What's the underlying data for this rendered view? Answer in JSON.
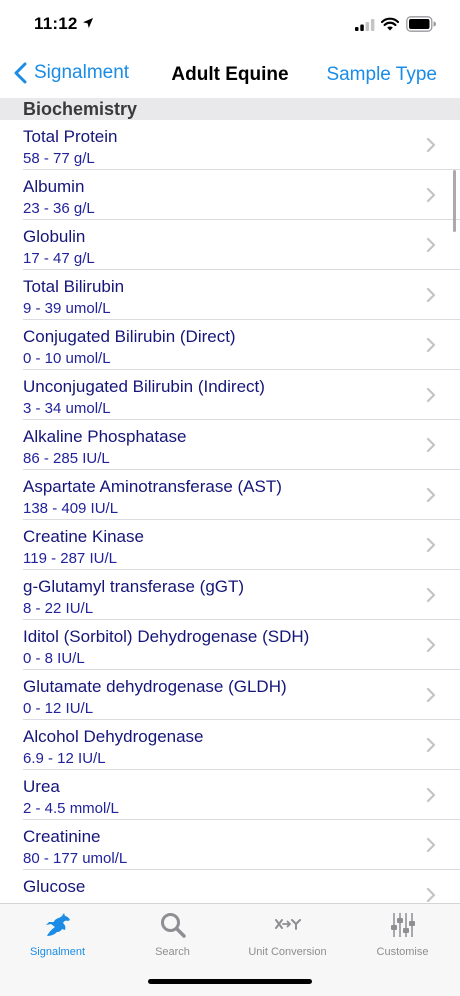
{
  "status_bar": {
    "time": "11:12"
  },
  "nav": {
    "back_label": "Signalment",
    "title": "Adult Equine",
    "right_label": "Sample Type"
  },
  "section": {
    "title": "Biochemistry"
  },
  "items": [
    {
      "name": "Total Protein",
      "range": "58 - 77 g/L"
    },
    {
      "name": "Albumin",
      "range": "23 - 36 g/L"
    },
    {
      "name": "Globulin",
      "range": "17 - 47 g/L"
    },
    {
      "name": "Total Bilirubin",
      "range": "9 - 39 umol/L"
    },
    {
      "name": "Conjugated Bilirubin (Direct)",
      "range": "0 - 10 umol/L"
    },
    {
      "name": "Unconjugated Bilirubin (Indirect)",
      "range": "3 - 34 umol/L"
    },
    {
      "name": "Alkaline Phosphatase",
      "range": "86 - 285 IU/L"
    },
    {
      "name": "Aspartate Aminotransferase (AST)",
      "range": "138 - 409 IU/L"
    },
    {
      "name": "Creatine Kinase",
      "range": "119 - 287 IU/L"
    },
    {
      "name": "g-Glutamyl transferase (gGT)",
      "range": "8 - 22 IU/L"
    },
    {
      "name": "Iditol (Sorbitol) Dehydrogenase (SDH)",
      "range": "0 - 8 IU/L"
    },
    {
      "name": "Glutamate dehydrogenase (GLDH)",
      "range": "0 - 12 IU/L"
    },
    {
      "name": "Alcohol Dehydrogenase",
      "range": "6.9 - 12 IU/L"
    },
    {
      "name": "Urea",
      "range": "2 - 4.5 mmol/L"
    },
    {
      "name": "Creatinine",
      "range": "80 - 177 umol/L"
    },
    {
      "name": "Glucose",
      "range": ""
    }
  ],
  "tabs": [
    {
      "label": "Signalment",
      "icon": "horse-icon",
      "active": true
    },
    {
      "label": "Search",
      "icon": "search-icon",
      "active": false
    },
    {
      "label": "Unit Conversion",
      "icon": "unit-conversion-icon",
      "active": false
    },
    {
      "label": "Customise",
      "icon": "sliders-icon",
      "active": false
    }
  ],
  "colors": {
    "accent": "#1a8ce6",
    "item_title": "#16167a",
    "item_range": "#22229a",
    "tab_inactive": "#8e8e93"
  }
}
